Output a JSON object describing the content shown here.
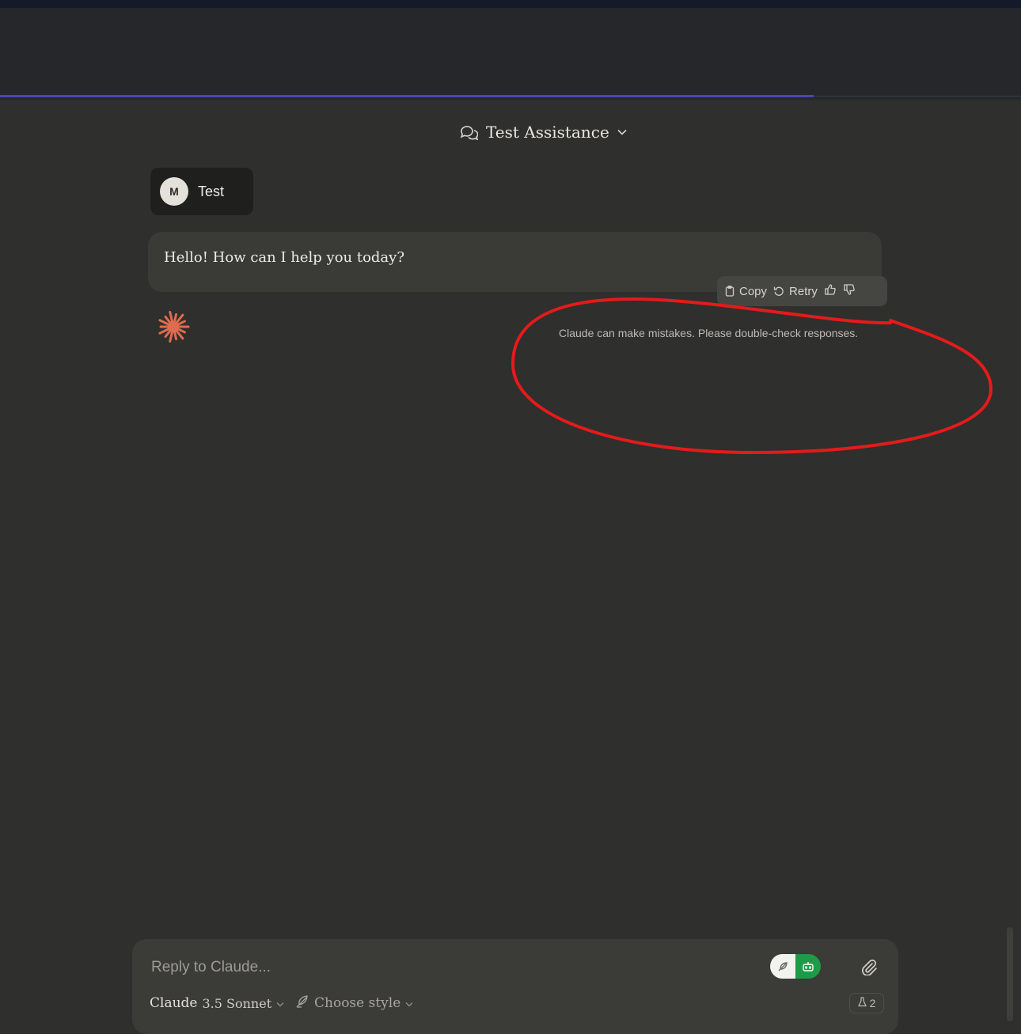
{
  "header": {
    "title": "Test Assistance",
    "title_icon": "chat-bubbles-icon",
    "dropdown_icon": "chevron-down-icon"
  },
  "user_message": {
    "avatar_initial": "M",
    "text": "Test"
  },
  "assistant_message": {
    "text": "Hello! How can I help you today?"
  },
  "message_actions": {
    "copy_label": "Copy",
    "retry_label": "Retry",
    "icons": [
      "clipboard-icon",
      "retry-icon",
      "thumbs-up-icon",
      "thumbs-down-icon"
    ]
  },
  "disclaimer": "Claude can make mistakes. Please double-check responses.",
  "composer": {
    "placeholder": "Reply to Claude...",
    "model_name": "Claude",
    "model_version": "3.5 Sonnet",
    "style_label": "Choose style",
    "count": "2",
    "icons": [
      "feather-icon",
      "robot-icon",
      "paperclip-icon",
      "flask-icon"
    ]
  },
  "colors": {
    "background": "#2f2f2d",
    "header_band": "#26272b",
    "accent_line": "#4b46b8",
    "claude_orange": "#e06b4f",
    "annotation_red": "#e31b1b",
    "toggle_green": "#1f9a48"
  }
}
